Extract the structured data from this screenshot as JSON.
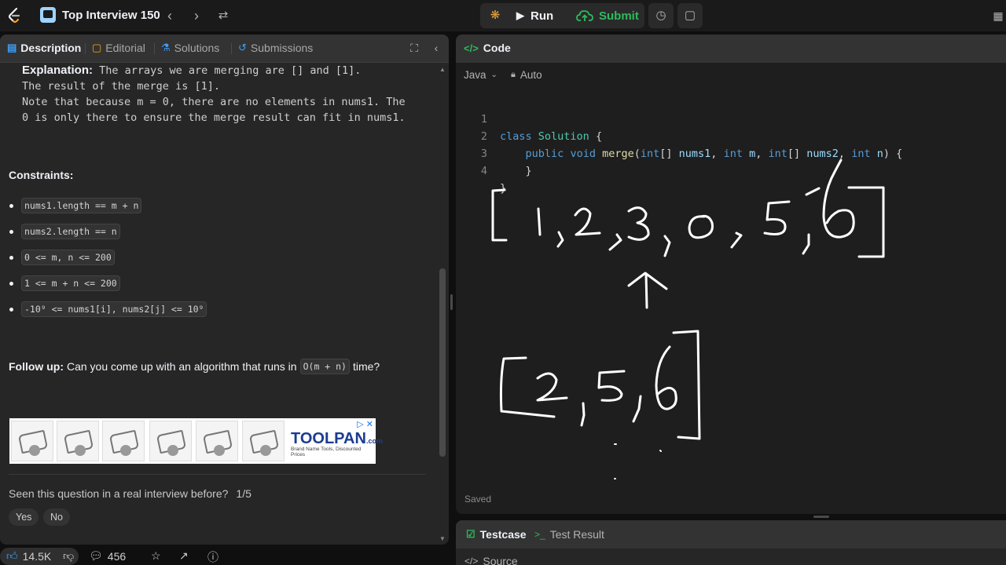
{
  "topbar": {
    "list_title": "Top Interview 150",
    "run_label": "Run",
    "submit_label": "Submit"
  },
  "left_tabs": {
    "description": "Description",
    "editorial": "Editorial",
    "solutions": "Solutions",
    "submissions": "Submissions"
  },
  "explanation": {
    "label": "Explanation:",
    "line1": " The arrays we are merging are [] and [1].",
    "line2": "The result of the merge is [1].",
    "line3": "Note that because m = 0, there are no elements in nums1. The",
    "line4": "0 is only there to ensure the merge result can fit in nums1."
  },
  "constraints": {
    "heading": "Constraints:",
    "items": [
      "nums1.length == m + n",
      "nums2.length == n",
      "0 <= m, n <= 200",
      "1 <= m + n <= 200",
      "-10⁹ <= nums1[i], nums2[j] <= 10⁹"
    ]
  },
  "followup": {
    "label": "Follow up:",
    "text_before": "Can you come up with an algorithm that runs in",
    "code": "O(m + n)",
    "text_after": "time?"
  },
  "ad": {
    "brand": "TOOLPAN",
    "brand_suffix": ".com",
    "tagline": "Brand Name Tools, Discounted Prices",
    "close": "▷ ✕"
  },
  "interview": {
    "question": "Seen this question in a real interview before?",
    "count": "1/5",
    "yes": "Yes",
    "no": "No"
  },
  "stats": {
    "likes": "14.5K",
    "comments": "456"
  },
  "code_panel": {
    "title": "Code",
    "language": "Java",
    "mode": "Auto",
    "saved": "Saved",
    "lines": [
      {
        "n": "1",
        "text": "class Solution {"
      },
      {
        "n": "2",
        "text": "    public void merge(int[] nums1, int m, int[] nums2, int n) {"
      },
      {
        "n": "3",
        "text": "    }"
      },
      {
        "n": "4",
        "text": "}"
      }
    ]
  },
  "test_panel": {
    "testcase": "Testcase",
    "result": "Test Result",
    "source": "Source"
  },
  "colors": {
    "submit_green": "#2cbb5d",
    "bug_orange": "#e8a33d",
    "active_tab_blue": "#3c9df6"
  }
}
